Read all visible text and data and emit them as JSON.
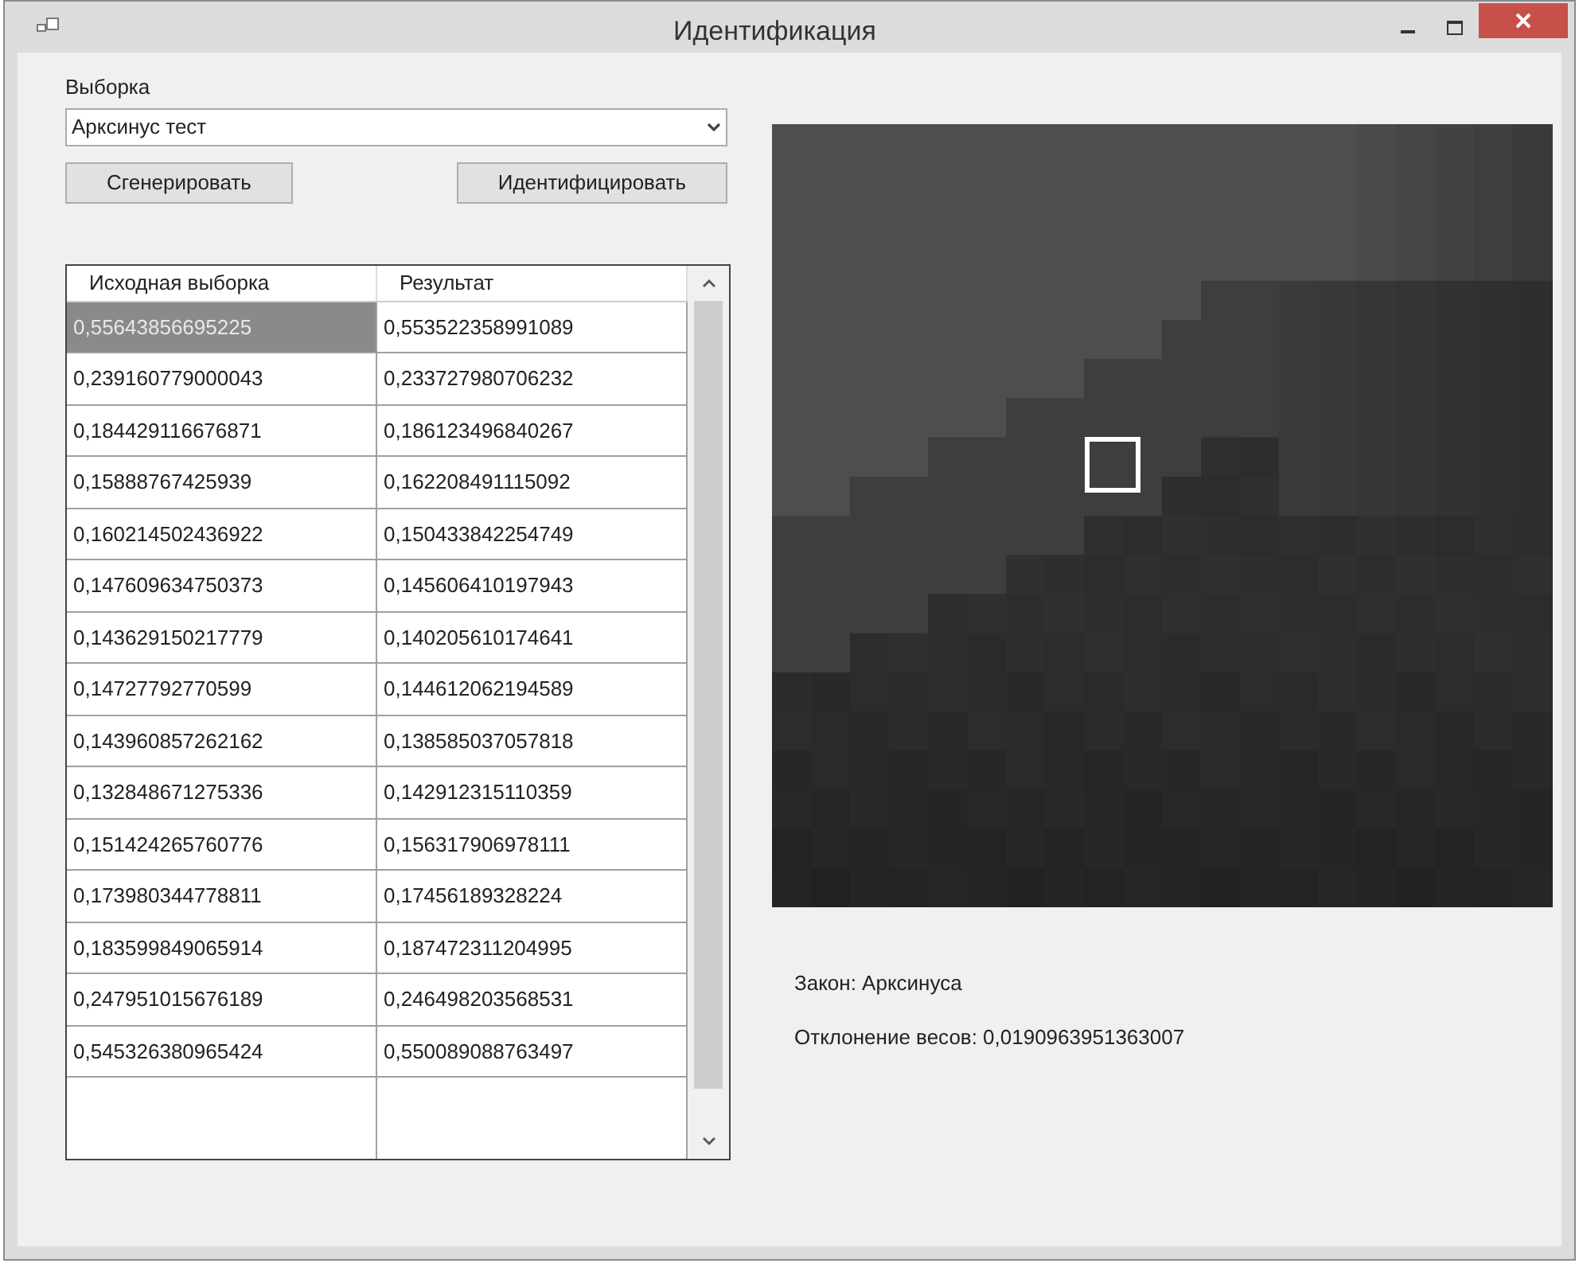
{
  "window": {
    "title": "Идентификация"
  },
  "sample": {
    "label": "Выборка",
    "value": "Арксинус тест"
  },
  "buttons": [
    "Сгенерировать",
    "Идентифицировать"
  ],
  "table": {
    "columns": [
      "Исходная выборка",
      "Результат"
    ],
    "rows": [
      {
        "cells": [
          "0,55643856695225",
          "0,553522358991089"
        ],
        "selected": true
      },
      {
        "cells": [
          "0,239160779000043",
          "0,233727980706232"
        ],
        "selected": false
      },
      {
        "cells": [
          "0,184429116676871",
          "0,186123496840267"
        ],
        "selected": false
      },
      {
        "cells": [
          "0,15888767425939",
          "0,162208491115092"
        ],
        "selected": false
      },
      {
        "cells": [
          "0,160214502436922",
          "0,150433842254749"
        ],
        "selected": false
      },
      {
        "cells": [
          "0,147609634750373",
          "0,145606410197943"
        ],
        "selected": false
      },
      {
        "cells": [
          "0,143629150217779",
          "0,140205610174641"
        ],
        "selected": false
      },
      {
        "cells": [
          "0,14727792770599",
          "0,144612062194589"
        ],
        "selected": false
      },
      {
        "cells": [
          "0,143960857262162",
          "0,138585037057818"
        ],
        "selected": false
      },
      {
        "cells": [
          "0,132848671275336",
          "0,142912315110359"
        ],
        "selected": false
      },
      {
        "cells": [
          "0,151424265760776",
          "0,156317906978111"
        ],
        "selected": false
      },
      {
        "cells": [
          "0,173980344778811",
          "0,17456189328224"
        ],
        "selected": false
      },
      {
        "cells": [
          "0,183599849065914",
          "0,187472311204995"
        ],
        "selected": false
      },
      {
        "cells": [
          "0,247951015676189",
          "0,246498203568531"
        ],
        "selected": false
      },
      {
        "cells": [
          "0,545326380965424",
          "0,550089088763497"
        ],
        "selected": false
      }
    ]
  },
  "results": [
    "Закон: Арксинуса",
    "Отклонение весов: 0,0190963951363007"
  ]
}
